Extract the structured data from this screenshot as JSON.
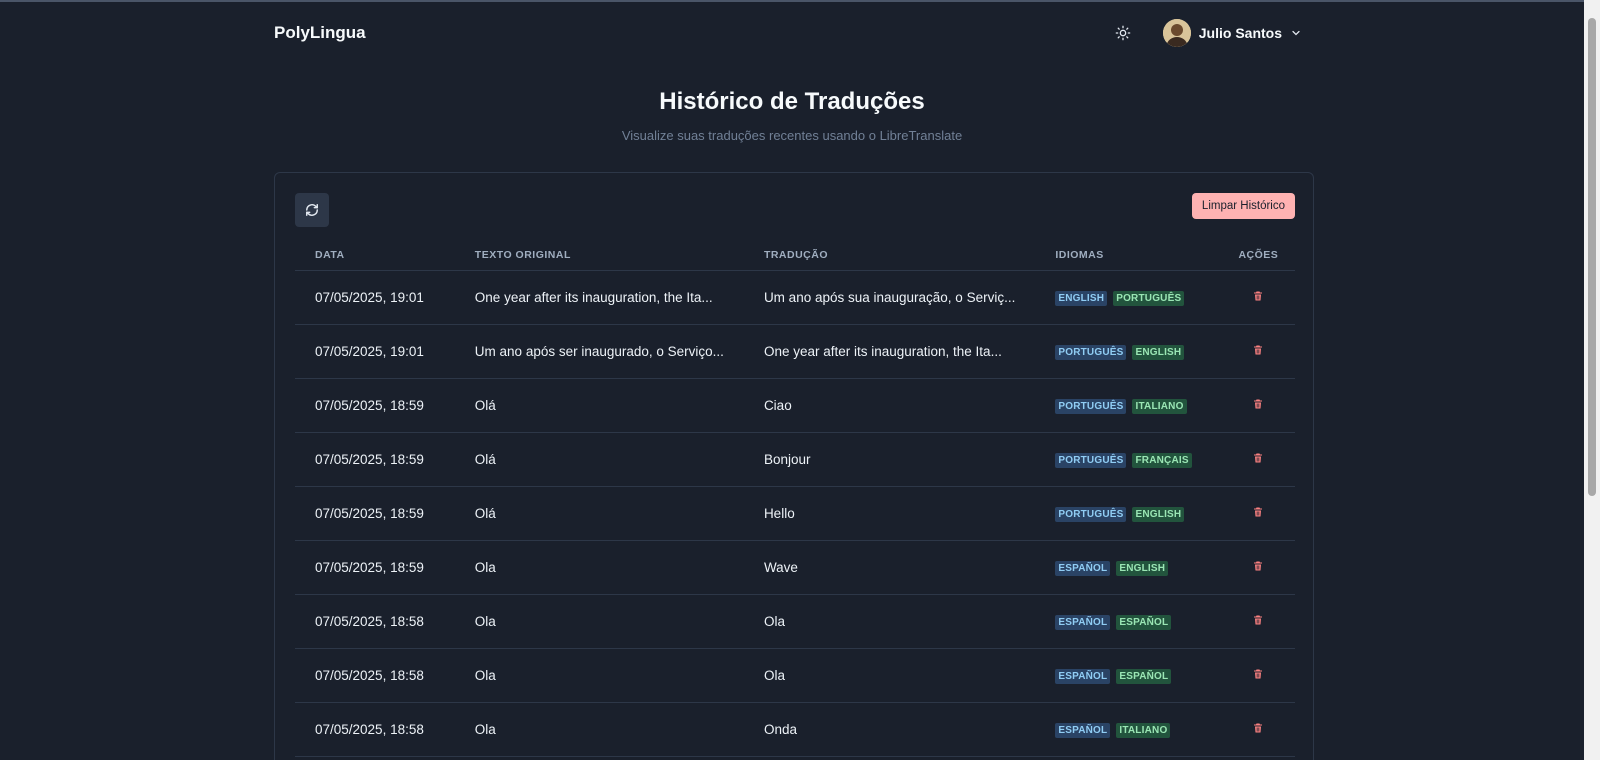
{
  "header": {
    "logo": "PolyLingua",
    "user_name": "Julio Santos"
  },
  "page": {
    "title": "Histórico de Traduções",
    "subtitle": "Visualize suas traduções recentes usando o LibreTranslate"
  },
  "toolbar": {
    "clear_label": "Limpar Histórico"
  },
  "table": {
    "columns": [
      "DATA",
      "TEXTO ORIGINAL",
      "TRADUÇÃO",
      "IDIOMAS",
      "AÇÕES"
    ],
    "rows": [
      {
        "date": "07/05/2025, 19:01",
        "original": "One year after its inauguration, the Ita...",
        "translation": "Um ano após sua inauguração, o Serviç...",
        "source_lang": "ENGLISH",
        "target_lang": "PORTUGUÊS"
      },
      {
        "date": "07/05/2025, 19:01",
        "original": "Um ano após ser inaugurado, o Serviço...",
        "translation": "One year after its inauguration, the Ita...",
        "source_lang": "PORTUGUÊS",
        "target_lang": "ENGLISH"
      },
      {
        "date": "07/05/2025, 18:59",
        "original": "Olá",
        "translation": "Ciao",
        "source_lang": "PORTUGUÊS",
        "target_lang": "ITALIANO"
      },
      {
        "date": "07/05/2025, 18:59",
        "original": "Olá",
        "translation": "Bonjour",
        "source_lang": "PORTUGUÊS",
        "target_lang": "FRANÇAIS"
      },
      {
        "date": "07/05/2025, 18:59",
        "original": "Olá",
        "translation": "Hello",
        "source_lang": "PORTUGUÊS",
        "target_lang": "ENGLISH"
      },
      {
        "date": "07/05/2025, 18:59",
        "original": "Ola",
        "translation": "Wave",
        "source_lang": "ESPAÑOL",
        "target_lang": "ENGLISH"
      },
      {
        "date": "07/05/2025, 18:58",
        "original": "Ola",
        "translation": "Ola",
        "source_lang": "ESPAÑOL",
        "target_lang": "ESPAÑOL"
      },
      {
        "date": "07/05/2025, 18:58",
        "original": "Ola",
        "translation": "Ola",
        "source_lang": "ESPAÑOL",
        "target_lang": "ESPAÑOL"
      },
      {
        "date": "07/05/2025, 18:58",
        "original": "Ola",
        "translation": "Onda",
        "source_lang": "ESPAÑOL",
        "target_lang": "ITALIANO"
      }
    ]
  },
  "icons": {
    "theme": "sun-icon",
    "dropdown": "chevron-down-icon",
    "refresh": "refresh-icon",
    "delete": "trash-icon"
  },
  "colors": {
    "background": "#1a202c",
    "danger": "#feb2b2",
    "trash_icon": "#fc8181",
    "source_badge_bg": "#2a4365",
    "source_badge_text": "#90cdf4",
    "target_badge_bg": "#22543d",
    "target_badge_text": "#9ae6b4"
  }
}
